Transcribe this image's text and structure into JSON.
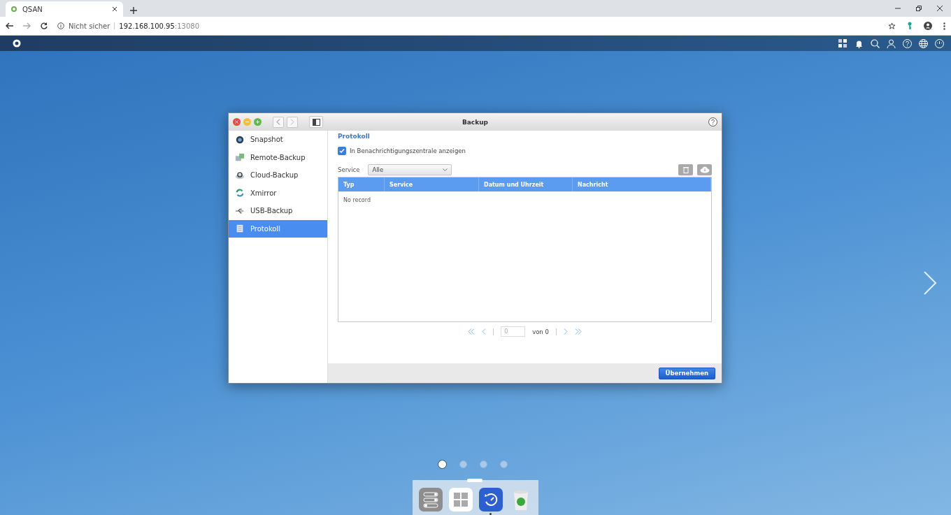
{
  "browser": {
    "tab": {
      "title": "QSAN"
    },
    "address": {
      "security": "Nicht sicher",
      "host": "192.168.100.95",
      "port": ":13080"
    }
  },
  "window": {
    "title": "Backup",
    "sidebar": {
      "items": [
        {
          "label": "Snapshot",
          "kind": "snapshot",
          "selected": false
        },
        {
          "label": "Remote-Backup",
          "kind": "remote",
          "selected": false
        },
        {
          "label": "Cloud-Backup",
          "kind": "cloud",
          "selected": false
        },
        {
          "label": "Xmirror",
          "kind": "xmirror",
          "selected": false
        },
        {
          "label": "USB-Backup",
          "kind": "usb",
          "selected": false
        },
        {
          "label": "Protokoll",
          "kind": "log",
          "selected": true
        }
      ]
    },
    "heading": "Protokoll",
    "notify_checkbox": {
      "label": "In Benachrichtigungszentrale anzeigen",
      "checked": true
    },
    "filter": {
      "label": "Service",
      "value": "Alle"
    },
    "table": {
      "columns": [
        "Typ",
        "Service",
        "Datum und Uhrzeit",
        "Nachricht"
      ],
      "empty_text": "No record"
    },
    "pager": {
      "page": "0",
      "total": "von 0"
    },
    "apply_button": "Übernehmen"
  },
  "page_dots": [
    {
      "selected": true
    },
    {
      "selected": false
    },
    {
      "selected": false
    },
    {
      "selected": false
    }
  ],
  "dock": [
    {
      "kind": "settings",
      "running": false
    },
    {
      "kind": "apps",
      "running": false
    },
    {
      "kind": "backup",
      "running": true
    },
    {
      "kind": "trash",
      "running": false
    }
  ]
}
